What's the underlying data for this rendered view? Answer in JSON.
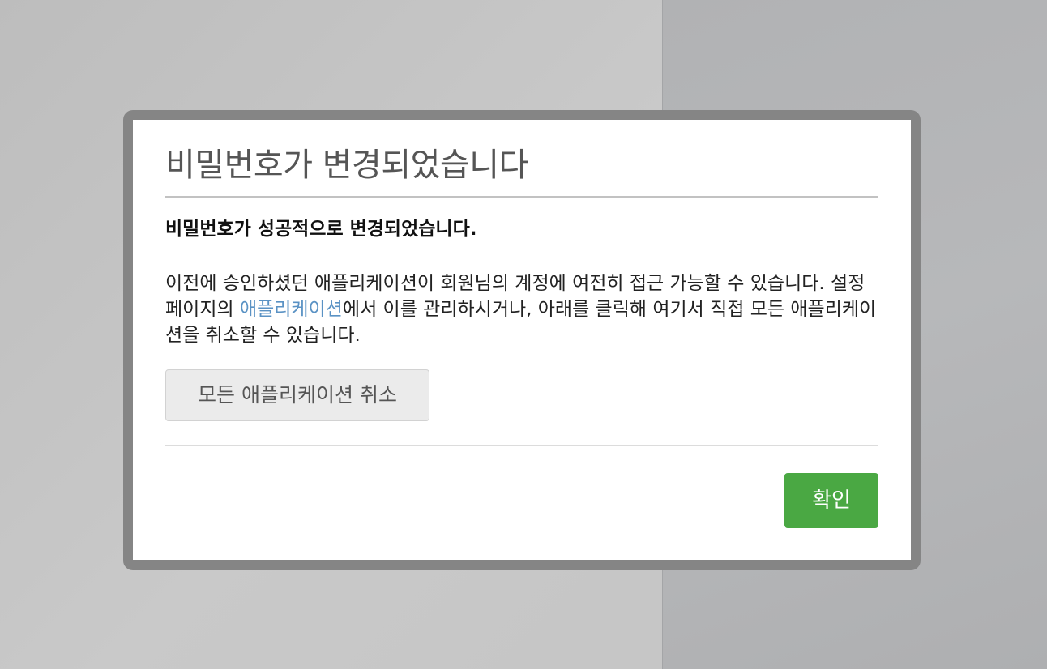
{
  "modal": {
    "title": "비밀번호가 변경되었습니다",
    "lead": "비밀번호가 성공적으로 변경되었습니다.",
    "desc": {
      "part1": "이전에 승인하셨던 애플리케이션이 회원님의 계정에 여전히 접근 가능할 수 있습니다. 설정 페이지의 ",
      "link": "애플리케이션",
      "part2": "에서 이를 관리하시거나, 아래를 클릭해 여기서 직접 모든 애플리케이션을 취소할 수 있습니다."
    },
    "revoke_button": "모든 애플리케이션 취소",
    "ok_button": "확인"
  },
  "colors": {
    "ok_button": "#4aa843",
    "link": "#5a92c4",
    "frame": "#858585"
  }
}
